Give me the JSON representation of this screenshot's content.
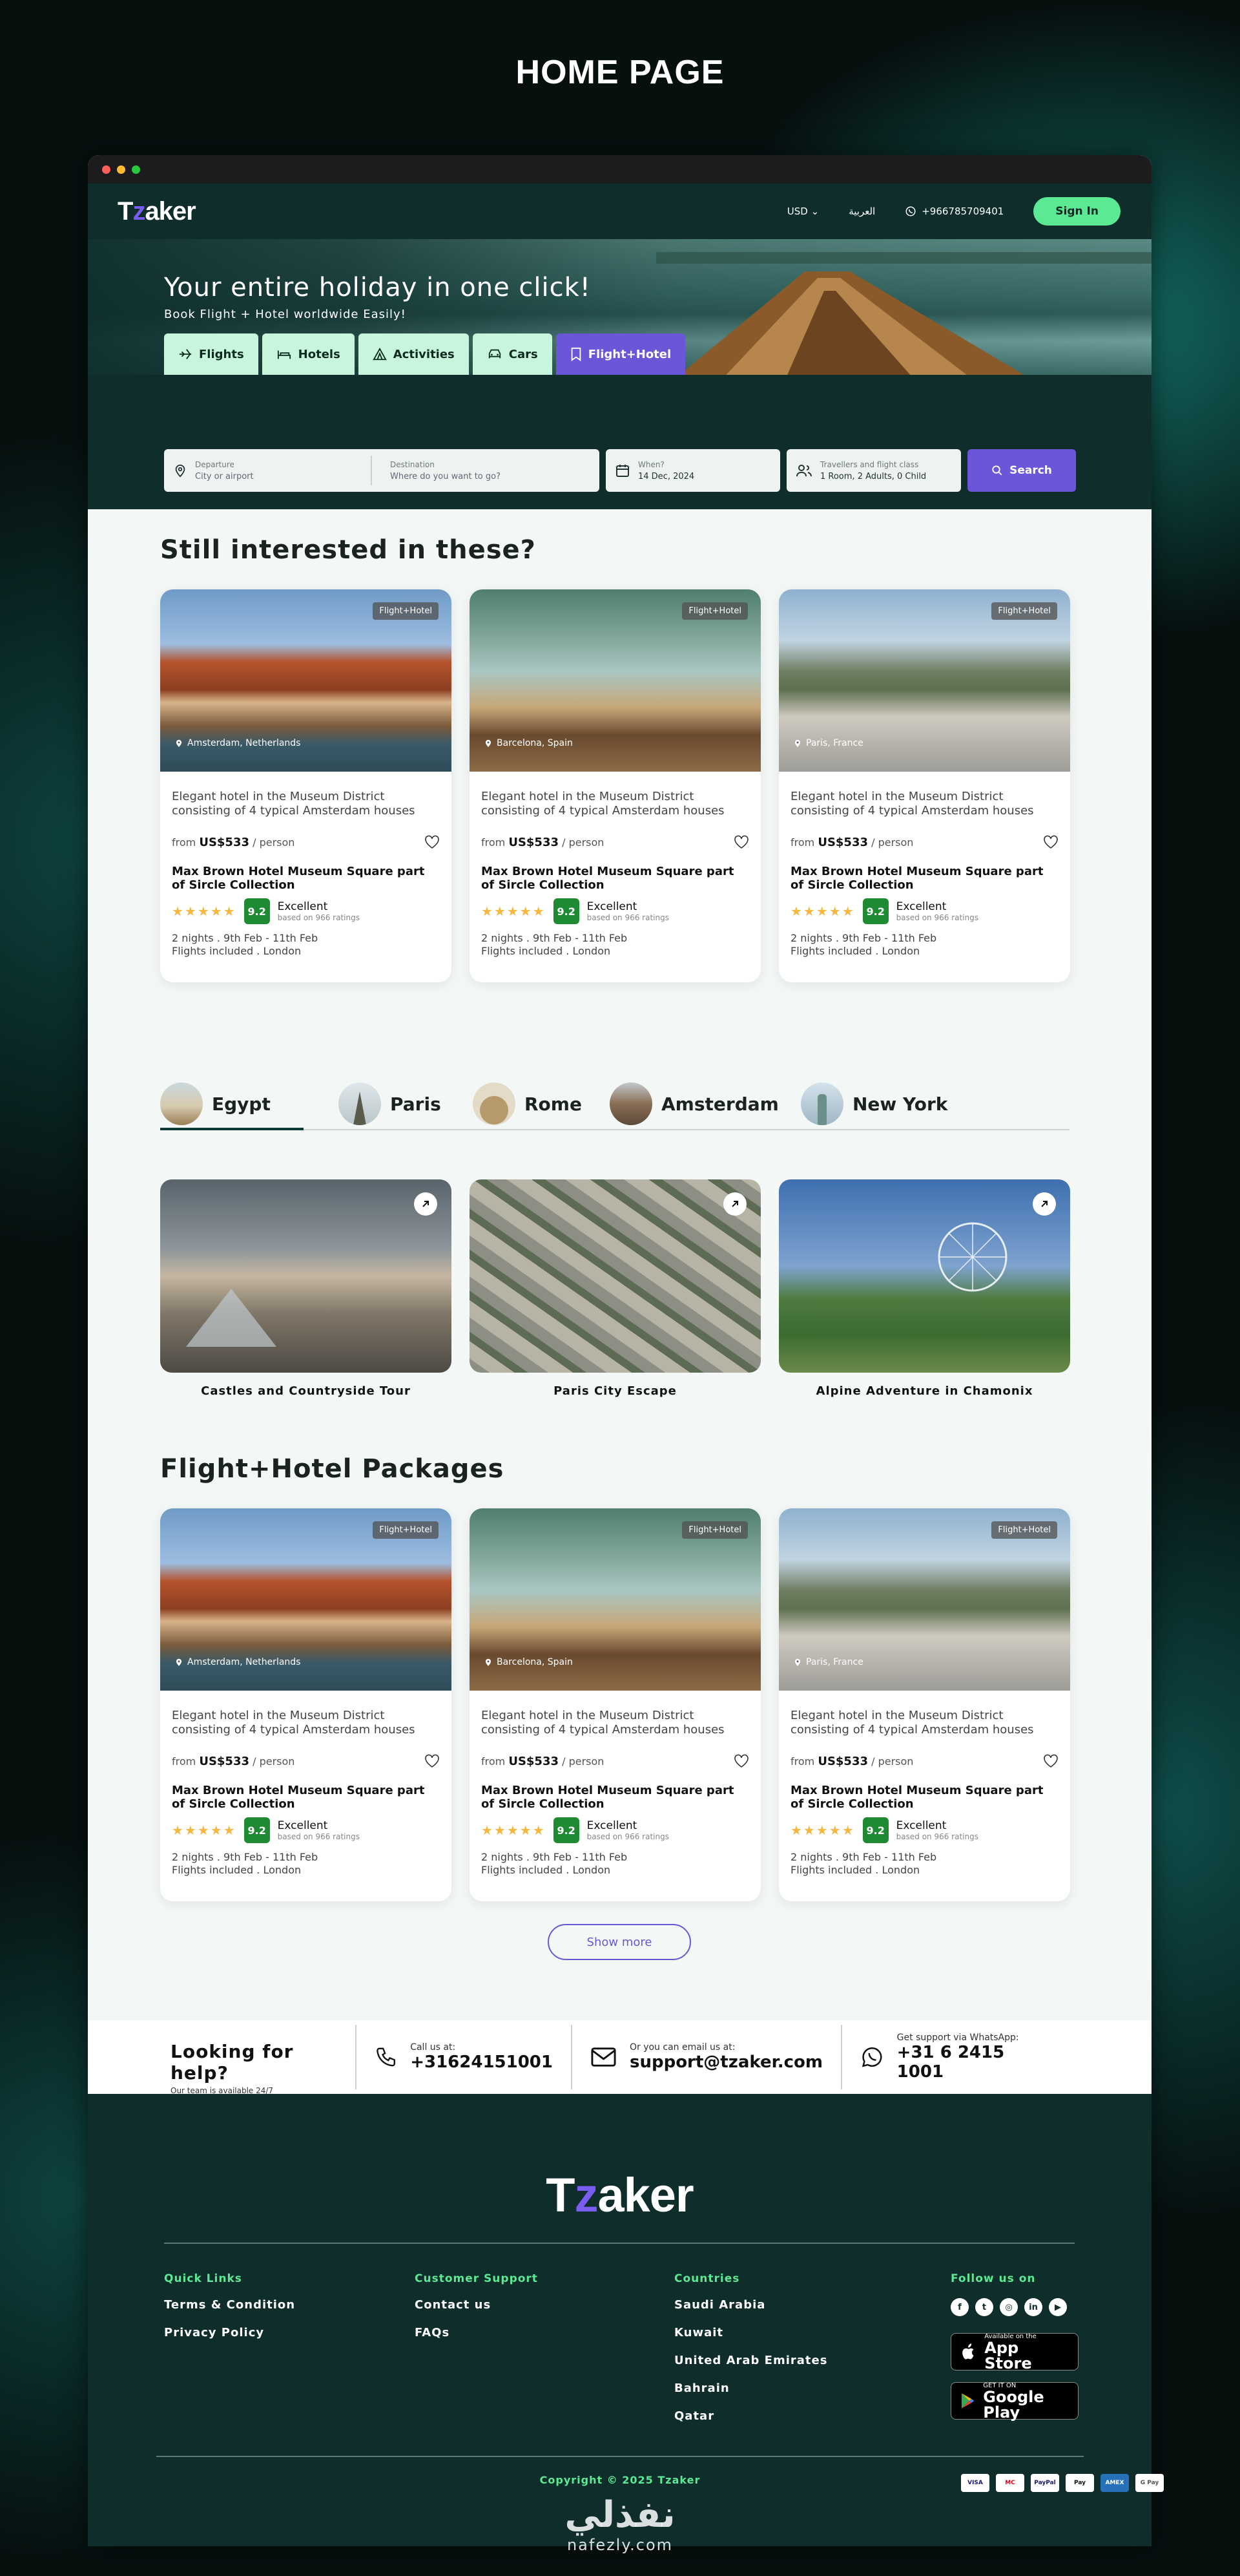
{
  "page": {
    "title": "HOME PAGE"
  },
  "header": {
    "logo": "Tzaker",
    "currency": "USD",
    "language": "العربية",
    "phone": "+966785709401",
    "signin": "Sign In"
  },
  "hero": {
    "headline": "Your entire holiday in one click!",
    "subline": "Book Flight + Hotel  worldwide Easily!",
    "tabs": [
      {
        "label": "Flights",
        "icon": "plane-icon"
      },
      {
        "label": "Hotels",
        "icon": "bed-icon"
      },
      {
        "label": "Activities",
        "icon": "tent-icon"
      },
      {
        "label": "Cars",
        "icon": "car-icon"
      },
      {
        "label": "Flight+Hotel",
        "icon": "bookmark-icon",
        "active": true
      }
    ]
  },
  "search": {
    "departure_label": "Departure",
    "departure_placeholder": "City or airport",
    "destination_label": "Destination",
    "destination_placeholder": "Where do you want to go?",
    "when_label": "When?",
    "when_value": "14 Dec, 2024",
    "travellers_label": "Travellers and flight class",
    "travellers_value": "1 Room, 2 Adults, 0 Child",
    "button": "Search"
  },
  "interested": {
    "title": "Still interested in these?",
    "cards": [
      {
        "badge": "Flight+Hotel",
        "location": "Amsterdam, Netherlands",
        "desc": "Elegant hotel in the Museum District consisting of 4 typical Amsterdam houses",
        "from": "from",
        "price": "US$533",
        "per": "/ person",
        "name": "Max Brown Hotel Museum Square part of Sircle Collection",
        "score": "9.2",
        "rating": "Excellent",
        "based": "based on 966 ratings",
        "trip1": "2 nights . 9th Feb - 11th Feb",
        "trip2": "Flights included . London"
      },
      {
        "badge": "Flight+Hotel",
        "location": "Barcelona, Spain",
        "desc": "Elegant hotel in the Museum District consisting of 4 typical Amsterdam houses",
        "from": "from",
        "price": "US$533",
        "per": "/ person",
        "name": "Max Brown Hotel Museum Square part of Sircle Collection",
        "score": "9.2",
        "rating": "Excellent",
        "based": "based on 966 ratings",
        "trip1": "2 nights . 9th Feb - 11th Feb",
        "trip2": "Flights included . London"
      },
      {
        "badge": "Flight+Hotel",
        "location": "Paris, France",
        "desc": "Elegant hotel in the Museum District consisting of 4 typical Amsterdam houses",
        "from": "from",
        "price": "US$533",
        "per": "/ person",
        "name": "Max Brown Hotel Museum Square part of Sircle Collection",
        "score": "9.2",
        "rating": "Excellent",
        "based": "based on 966 ratings",
        "trip1": "2 nights . 9th Feb - 11th Feb",
        "trip2": "Flights included . London"
      }
    ]
  },
  "destinations": {
    "tabs": [
      "Egypt",
      "Paris",
      "Rome",
      "Amsterdam",
      "New York"
    ],
    "tours": [
      "Castles and Countryside Tour",
      "Paris City Escape",
      "Alpine Adventure in Chamonix"
    ]
  },
  "packages": {
    "title": "Flight+Hotel Packages",
    "cards": [
      {
        "badge": "Flight+Hotel",
        "location": "Amsterdam, Netherlands",
        "desc": "Elegant hotel in the Museum District consisting of 4 typical Amsterdam houses",
        "from": "from",
        "price": "US$533",
        "per": "/ person",
        "name": "Max Brown Hotel Museum Square part of Sircle Collection",
        "score": "9.2",
        "rating": "Excellent",
        "based": "based on 966 ratings",
        "trip1": "2 nights . 9th Feb - 11th Feb",
        "trip2": "Flights included . London"
      },
      {
        "badge": "Flight+Hotel",
        "location": "Barcelona, Spain",
        "desc": "Elegant hotel in the Museum District consisting of 4 typical Amsterdam houses",
        "from": "from",
        "price": "US$533",
        "per": "/ person",
        "name": "Max Brown Hotel Museum Square part of Sircle Collection",
        "score": "9.2",
        "rating": "Excellent",
        "based": "based on 966 ratings",
        "trip1": "2 nights . 9th Feb - 11th Feb",
        "trip2": "Flights included . London"
      },
      {
        "badge": "Flight+Hotel",
        "location": "Paris, France",
        "desc": "Elegant hotel in the Museum District consisting of 4 typical Amsterdam houses",
        "from": "from",
        "price": "US$533",
        "per": "/ person",
        "name": "Max Brown Hotel Museum Square part of Sircle Collection",
        "score": "9.2",
        "rating": "Excellent",
        "based": "based on 966 ratings",
        "trip1": "2 nights . 9th Feb - 11th Feb",
        "trip2": "Flights included . London"
      }
    ],
    "show_more": "Show more"
  },
  "help": {
    "title": "Looking for help?",
    "subtitle": "Our team is available 24/7",
    "call_label": "Call us at:",
    "call_value": "+31624151001",
    "email_label": "Or you can email us at:",
    "email_value": "support@tzaker.com",
    "whatsapp_label": "Get support via WhatsApp:",
    "whatsapp_value": "+31 6 2415 1001"
  },
  "footer": {
    "logo": "Tzaker",
    "quick_links": {
      "title": "Quick Links",
      "items": [
        "Terms & Condition",
        "Privacy Policy"
      ]
    },
    "support": {
      "title": "Customer Support",
      "items": [
        "Contact us",
        "FAQs"
      ]
    },
    "countries": {
      "title": "Countries",
      "items": [
        "Saudi Arabia",
        "Kuwait",
        "United Arab Emirates",
        "Bahrain",
        "Qatar"
      ]
    },
    "follow": {
      "title": "Follow us on"
    },
    "appstore": {
      "small": "Available on the",
      "big": "App Store"
    },
    "googleplay": {
      "small": "GET IT ON",
      "big": "Google Play"
    },
    "copyright": "Copyright © 2025 Tzaker",
    "payments": [
      "VISA",
      "MC",
      "PayPal",
      "Pay",
      "AMEX",
      "G Pay"
    ]
  },
  "watermark": {
    "arabic": "نفذلي",
    "latin": "nafezly.com"
  },
  "colors": {
    "brand_dark": "#0e2d2b",
    "accent_green": "#5bea93",
    "accent_purple": "#6b56d8",
    "score_green": "#1e8b32"
  }
}
